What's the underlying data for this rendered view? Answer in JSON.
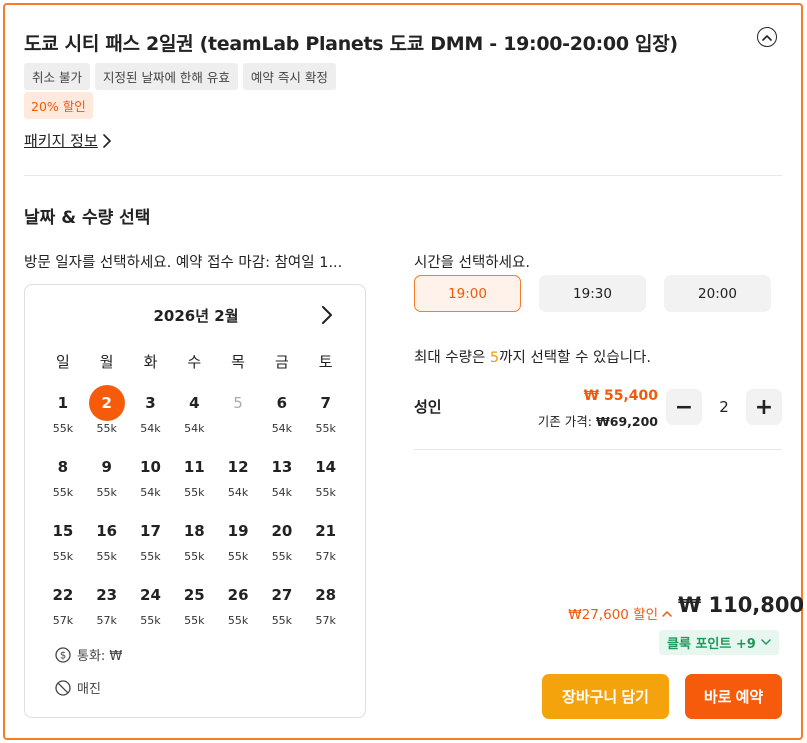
{
  "product": {
    "title": "도쿄 시티 패스 2일권 (teamLab Planets 도쿄 DMM - 19:00-20:00 입장)",
    "tags": [
      "취소 불가",
      "지정된 날짜에 한해 유효",
      "예약 즉시 확정"
    ],
    "discount_tag": "20% 할인",
    "package_info_link": "패키지 정보"
  },
  "selection": {
    "section_title": "날짜 & 수량 선택",
    "visit_prompt": "방문 일자를 선택하세요. 예약 접수 마감: 참여일 1...",
    "calendar": {
      "month_label": "2026년 2월",
      "weekdays": [
        "일",
        "월",
        "화",
        "수",
        "목",
        "금",
        "토"
      ],
      "weeks": [
        [
          {
            "d": "1",
            "p": "55k"
          },
          {
            "d": "2",
            "p": "55k",
            "selected": true
          },
          {
            "d": "3",
            "p": "54k"
          },
          {
            "d": "4",
            "p": "54k"
          },
          {
            "d": "5",
            "p": "",
            "disabled": true
          },
          {
            "d": "6",
            "p": "54k"
          },
          {
            "d": "7",
            "p": "55k"
          }
        ],
        [
          {
            "d": "8",
            "p": "55k"
          },
          {
            "d": "9",
            "p": "55k"
          },
          {
            "d": "10",
            "p": "54k"
          },
          {
            "d": "11",
            "p": "55k"
          },
          {
            "d": "12",
            "p": "54k"
          },
          {
            "d": "13",
            "p": "54k"
          },
          {
            "d": "14",
            "p": "55k"
          }
        ],
        [
          {
            "d": "15",
            "p": "55k"
          },
          {
            "d": "16",
            "p": "55k"
          },
          {
            "d": "17",
            "p": "55k"
          },
          {
            "d": "18",
            "p": "55k"
          },
          {
            "d": "19",
            "p": "55k"
          },
          {
            "d": "20",
            "p": "55k"
          },
          {
            "d": "21",
            "p": "57k"
          }
        ],
        [
          {
            "d": "22",
            "p": "57k"
          },
          {
            "d": "23",
            "p": "57k"
          },
          {
            "d": "24",
            "p": "55k"
          },
          {
            "d": "25",
            "p": "55k"
          },
          {
            "d": "26",
            "p": "55k"
          },
          {
            "d": "27",
            "p": "55k"
          },
          {
            "d": "28",
            "p": "57k"
          }
        ]
      ],
      "currency_legend": "통화: ₩",
      "soldout_legend": "매진"
    },
    "time_prompt": "시간을 선택하세요.",
    "time_slots": [
      {
        "label": "19:00",
        "active": true
      },
      {
        "label": "19:30",
        "active": false
      },
      {
        "label": "20:00",
        "active": false
      }
    ],
    "max_qty_prefix": "최대 수량은 ",
    "max_qty_value": "5",
    "max_qty_suffix": "까지 선택할 수 있습니다.",
    "adult_label": "성인",
    "adult_price": "₩ 55,400",
    "orig_price_label": "기존 가격: ",
    "orig_price_value": "₩69,200",
    "quantity": "2",
    "minus_symbol": "−",
    "plus_symbol": "+"
  },
  "summary": {
    "discount_text": "₩27,600 할인",
    "total": "₩ 110,800",
    "points": "클룩 포인트 +9",
    "cart_button": "장바구니 담기",
    "book_button": "바로 예약"
  },
  "colors": {
    "accent": "#f55b0b",
    "cart": "#f5a30c",
    "points": "#1c9a5a"
  }
}
